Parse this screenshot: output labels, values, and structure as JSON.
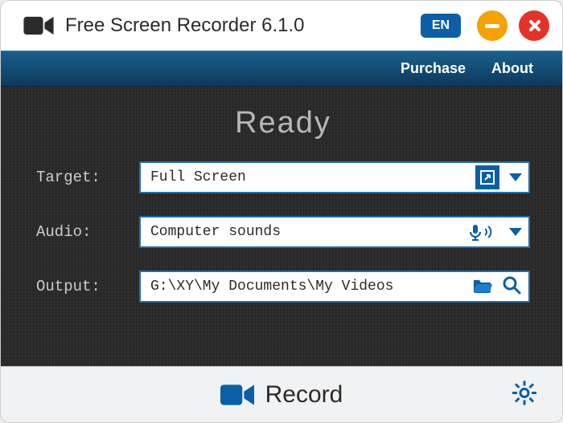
{
  "window": {
    "title": "Free Screen Recorder 6.1.0",
    "language": "EN"
  },
  "menu": {
    "purchase": "Purchase",
    "about": "About"
  },
  "status": "Ready",
  "fields": {
    "target": {
      "label": "Target:",
      "value": "Full Screen"
    },
    "audio": {
      "label": "Audio:",
      "value": "Computer sounds"
    },
    "output": {
      "label": "Output:",
      "value": "G:\\XY\\My Documents\\My Videos"
    }
  },
  "actions": {
    "record": "Record"
  }
}
